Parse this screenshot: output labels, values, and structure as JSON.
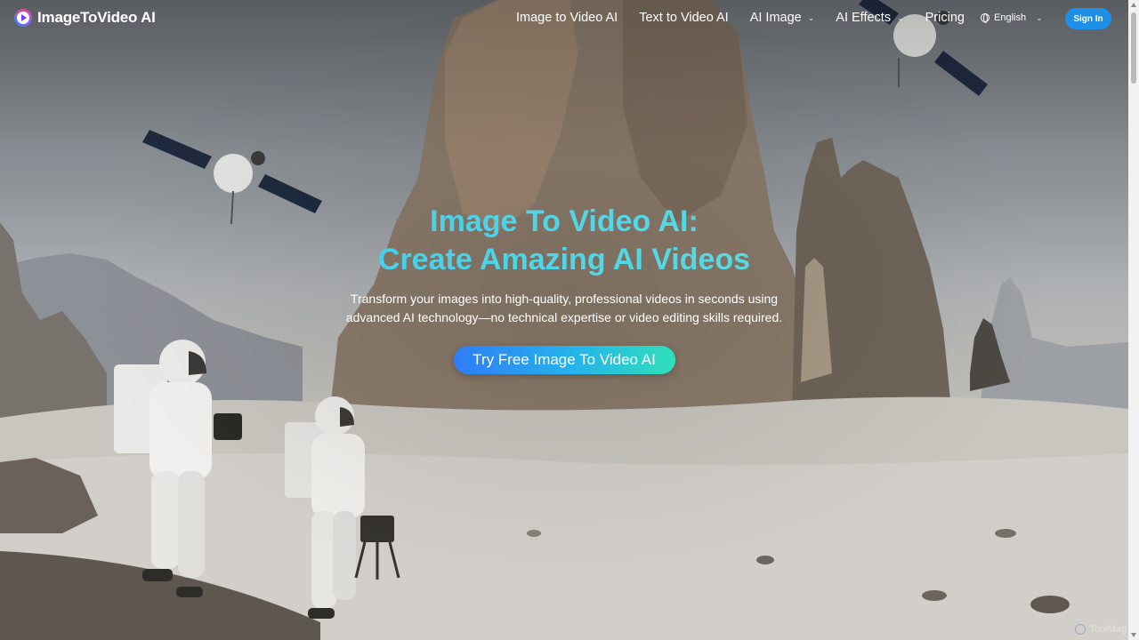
{
  "brand": {
    "name": "ImageToVideo AI",
    "logo_icon": "play-circle-icon"
  },
  "nav": {
    "items": [
      {
        "label": "Image to Video AI",
        "has_dropdown": false
      },
      {
        "label": "Text to Video AI",
        "has_dropdown": false
      },
      {
        "label": "AI Image",
        "has_dropdown": true
      },
      {
        "label": "AI Effects",
        "has_dropdown": true
      },
      {
        "label": "Pricing",
        "has_dropdown": false
      }
    ],
    "language": "English",
    "sign_in": "Sign In"
  },
  "hero": {
    "title_line1": "Image To Video AI:",
    "title_line2": "Create Amazing AI Videos",
    "subtitle": "Transform your images into high-quality, professional videos in seconds using advanced AI technology—no technical expertise or video editing skills required.",
    "cta": "Try Free Image To Video AI"
  },
  "watermark": "ToolMag",
  "colors": {
    "accent": "#1d8fe6",
    "title_gradient_start": "#33c3f0",
    "title_gradient_end": "#69e0d2",
    "cta_gradient_start": "#2f7cf6",
    "cta_gradient_end": "#2fe0b8"
  }
}
